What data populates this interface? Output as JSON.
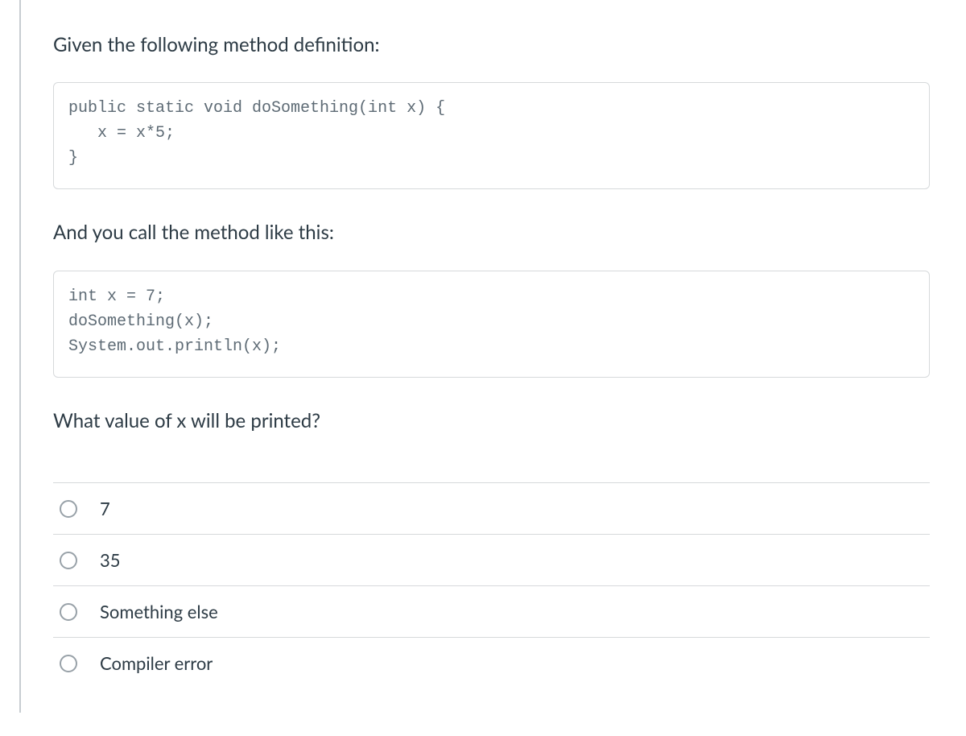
{
  "question": {
    "intro1": "Given the following method definition:",
    "code1": "public static void doSomething(int x) {\n   x = x*5;\n}",
    "intro2": "And you call the method like this:",
    "code2": "int x = 7;\ndoSomething(x);\nSystem.out.println(x);",
    "prompt": "What value of x will be printed?"
  },
  "options": [
    {
      "label": "7"
    },
    {
      "label": "35"
    },
    {
      "label": "Something else"
    },
    {
      "label": "Compiler error"
    }
  ]
}
